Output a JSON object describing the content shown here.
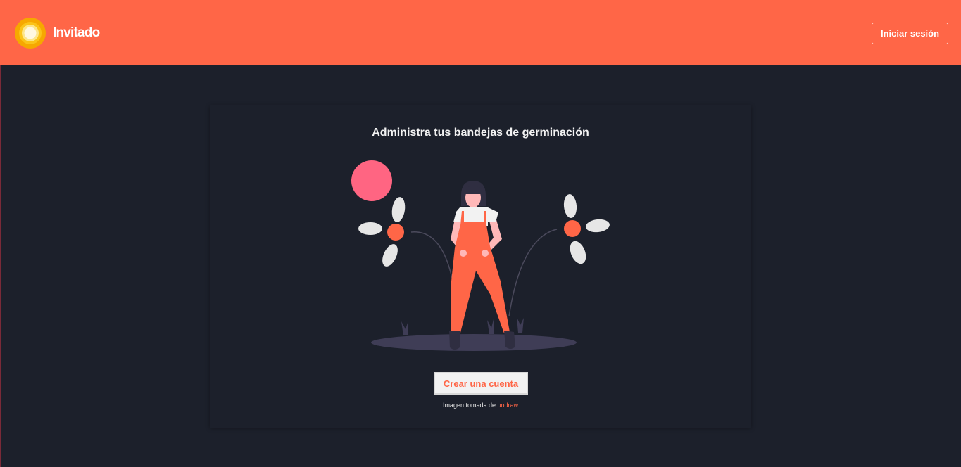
{
  "navbar": {
    "brand_name": "Invitado",
    "login_label": "Iniciar sesión"
  },
  "card": {
    "title": "Administra tus bandejas de germinación",
    "create_account_label": "Crear una cuenta",
    "credit_prefix": "Imagen tomada de",
    "credit_link": "undraw"
  },
  "colors": {
    "accent": "#ff6647",
    "background": "#1c202b",
    "logo_outer": "#f9b400",
    "logo_inner": "#fbd13a",
    "sun_pink": "#ff6582",
    "petal": "#e6e6e6",
    "ground": "#3f3d56"
  },
  "icons": {
    "logo": "sun-logo-icon",
    "illustration": "gardener-flowers-illustration"
  }
}
